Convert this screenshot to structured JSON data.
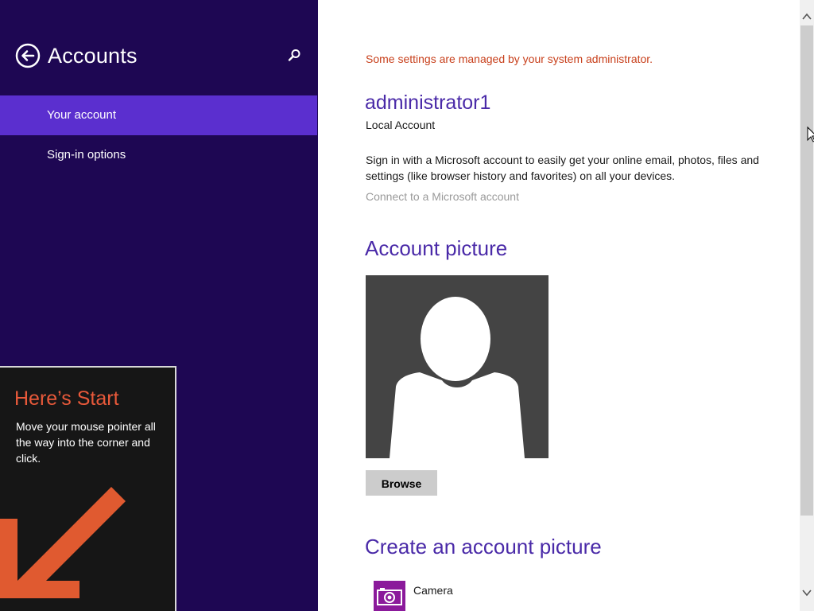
{
  "sidebar": {
    "title": "Accounts",
    "items": [
      {
        "label": "Your account",
        "selected": true
      },
      {
        "label": "Sign-in options",
        "selected": false
      }
    ]
  },
  "start_tip": {
    "title": "Here’s Start",
    "body": "Move your mouse pointer all the way into the corner and click."
  },
  "main": {
    "admin_notice": "Some settings are managed by your system administrator.",
    "account_name": "administrator1",
    "account_type": "Local Account",
    "ms_description": "Sign in with a Microsoft account to easily get your online email, photos, files and settings (like browser history and favorites) on all your devices.",
    "connect_link": "Connect to a Microsoft account",
    "account_picture_heading": "Account picture",
    "browse_label": "Browse",
    "create_heading": "Create an account picture",
    "create_options": [
      {
        "label": "Camera",
        "icon": "camera-icon"
      }
    ]
  },
  "colors": {
    "sidebar_bg": "#1e0753",
    "selected_item_bg": "#5b2fcf",
    "heading_purple": "#4a2aa8",
    "notice_orange": "#c8401c",
    "tip_accent": "#e8593a",
    "camera_tile": "#8b1a9b"
  },
  "icons": {
    "back": "back-arrow-icon",
    "search": "search-icon",
    "tip_arrow": "arrow-down-left-icon",
    "picture": "user-silhouette-icon",
    "camera": "camera-icon",
    "scroll_up": "chevron-up-icon",
    "scroll_down": "chevron-down-icon"
  }
}
